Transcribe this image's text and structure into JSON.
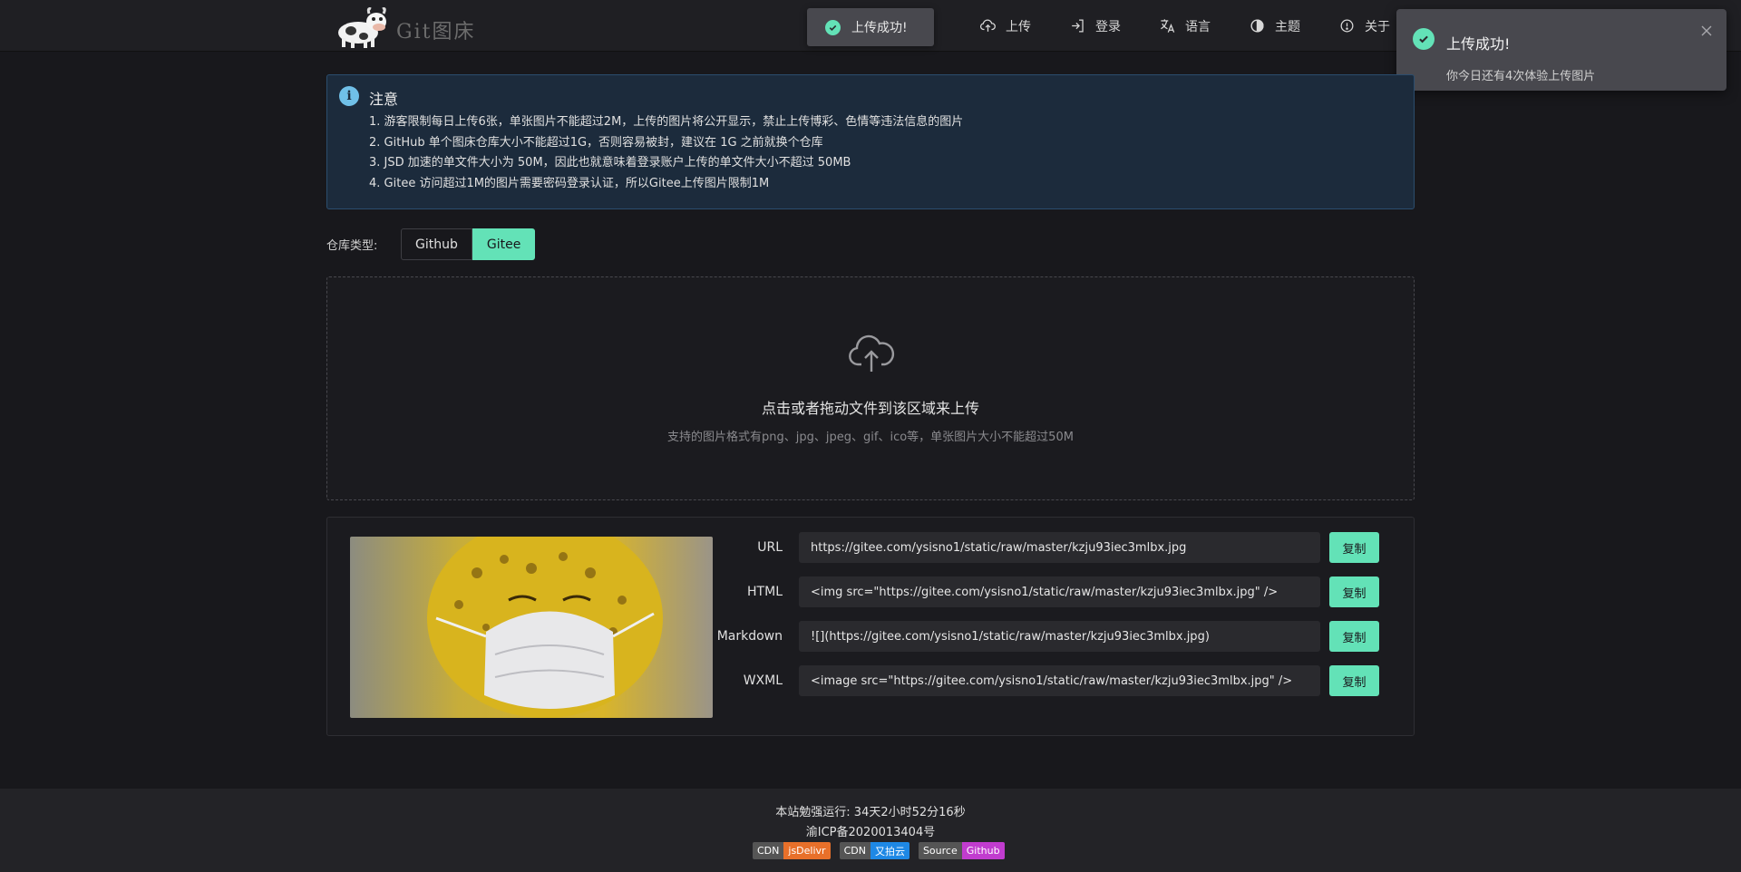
{
  "header": {
    "logo_text": "Git图床",
    "nav": [
      {
        "label": "上传",
        "icon": "cloud-upload-icon"
      },
      {
        "label": "登录",
        "icon": "login-icon"
      },
      {
        "label": "语言",
        "icon": "translate-icon"
      },
      {
        "label": "主题",
        "icon": "contrast-icon"
      },
      {
        "label": "关于",
        "icon": "info-icon"
      }
    ]
  },
  "toast": {
    "message": "上传成功!"
  },
  "notification": {
    "title": "上传成功!",
    "body": "你今日还有4次体验上传图片"
  },
  "notice": {
    "title": "注意",
    "items": [
      "1. 游客限制每日上传6张，单张图片不能超过2M，上传的图片将公开显示，禁止上传博彩、色情等违法信息的图片",
      "2. GitHub 单个图床仓库大小不能超过1G，否则容易被封，建议在 1G 之前就换个仓库",
      "3. JSD 加速的单文件大小为 50M，因此也就意味着登录账户上传的单文件大小不超过 50MB",
      "4. Gitee 访问超过1M的图片需要密码登录认证，所以Gitee上传图片限制1M"
    ]
  },
  "repo": {
    "label": "仓库类型:",
    "options": [
      "Github",
      "Gitee"
    ],
    "selected": "Gitee"
  },
  "dropzone": {
    "main": "点击或者拖动文件到该区域来上传",
    "sub": "支持的图片格式有png、jpg、jpeg、gif、ico等，单张图片大小不能超过50M"
  },
  "result": {
    "copy_label": "复制",
    "rows": [
      {
        "label": "URL",
        "value": "https://gitee.com/ysisno1/static/raw/master/kzju93iec3mlbx.jpg"
      },
      {
        "label": "HTML",
        "value": "<img src=\"https://gitee.com/ysisno1/static/raw/master/kzju93iec3mlbx.jpg\" />"
      },
      {
        "label": "Markdown",
        "value": "![](https://gitee.com/ysisno1/static/raw/master/kzju93iec3mlbx.jpg)"
      },
      {
        "label": "WXML",
        "value": "<image src=\"https://gitee.com/ysisno1/static/raw/master/kzju93iec3mlbx.jpg\" />"
      }
    ]
  },
  "footer": {
    "runtime": "本站勉强运行: 34天2小时52分16秒",
    "icp": "渝ICP备2020013404号",
    "badges": [
      {
        "key": "CDN",
        "value": "jsDelivr",
        "color": "#e8702a"
      },
      {
        "key": "CDN",
        "value": "又拍云",
        "color": "#1e88e5"
      },
      {
        "key": "Source",
        "value": "Github",
        "color": "#c13ccf"
      }
    ]
  },
  "colors": {
    "accent": "#63e2b7",
    "info": "#70c0e8",
    "background": "#18181c"
  }
}
